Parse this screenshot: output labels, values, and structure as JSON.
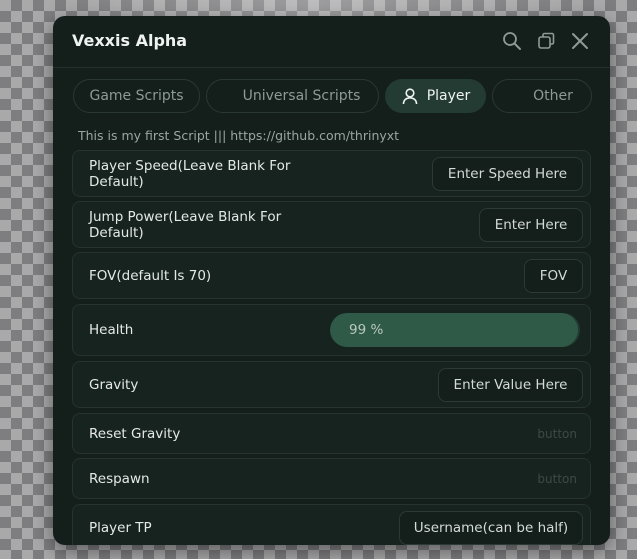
{
  "window": {
    "title": "Vexxis Alpha",
    "icons": [
      "search-icon",
      "restore-icon",
      "close-icon"
    ]
  },
  "tabs": [
    {
      "label": "Game Scripts",
      "active": false
    },
    {
      "label": "Universal Scripts",
      "active": false
    },
    {
      "label": "Player",
      "active": true,
      "icon": "person-icon"
    },
    {
      "label": "Other",
      "active": false
    }
  ],
  "subtitle": "This is my first Script ||| https://github.com/thrinyxt",
  "rows": {
    "player_speed": {
      "label": "Player Speed(Leave Blank For Default)",
      "placeholder": "Enter Speed Here"
    },
    "jump_power": {
      "label": "Jump Power(Leave Blank For Default)",
      "placeholder": "Enter Here"
    },
    "fov": {
      "label": "FOV(default Is 70)",
      "placeholder": "FOV"
    },
    "health": {
      "label": "Health",
      "value_text": "99 %",
      "value": 99,
      "max": 100
    },
    "gravity": {
      "label": "Gravity",
      "placeholder": "Enter Value Here"
    },
    "reset_gravity": {
      "label": "Reset Gravity",
      "hint": "button"
    },
    "respawn": {
      "label": "Respawn",
      "hint": "button"
    },
    "player_tp": {
      "label": "Player TP",
      "placeholder": "Username(can be half)"
    }
  },
  "colors": {
    "window_bg": "#141e1b",
    "row_bg": "#17231f",
    "accent": "#233b33",
    "slider_fill": "#2f5a47"
  }
}
